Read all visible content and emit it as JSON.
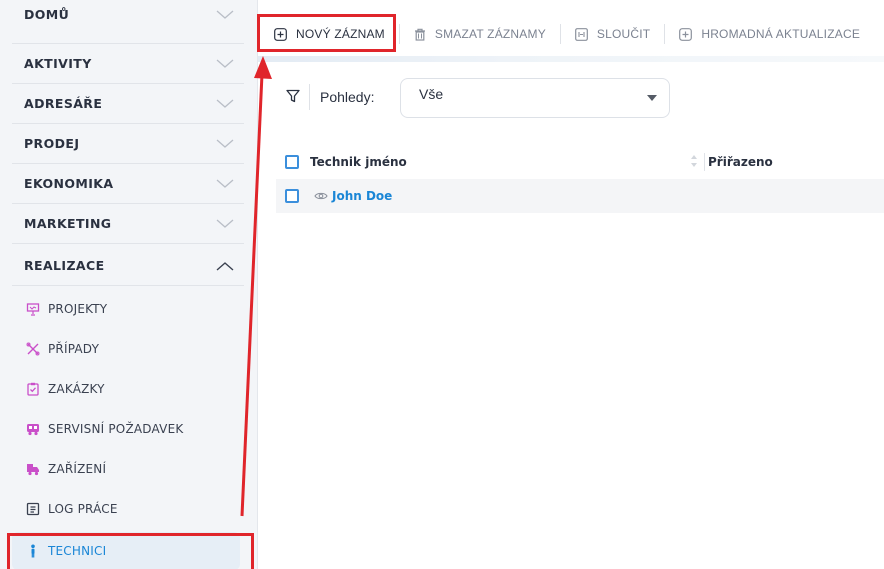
{
  "sidebar": {
    "sections": [
      {
        "label": "DOMŮ",
        "expanded": false
      },
      {
        "label": "AKTIVITY",
        "expanded": false
      },
      {
        "label": "ADRESÁŘE",
        "expanded": false
      },
      {
        "label": "PRODEJ",
        "expanded": false
      },
      {
        "label": "EKONOMIKA",
        "expanded": false
      },
      {
        "label": "MARKETING",
        "expanded": false
      },
      {
        "label": "REALIZACE",
        "expanded": true
      }
    ],
    "items": [
      {
        "label": "PROJEKTY",
        "icon": "presentation-icon",
        "color": "#c94fc9"
      },
      {
        "label": "PŘÍPADY",
        "icon": "tools-cross-icon",
        "color": "#c94fc9"
      },
      {
        "label": "ZAKÁZKY",
        "icon": "clipboard-check-icon",
        "color": "#c94fc9"
      },
      {
        "label": "SERVISNÍ POŽADAVEK",
        "icon": "truck-icon",
        "color": "#c94fc9"
      },
      {
        "label": "ZAŘÍZENÍ",
        "icon": "vehicle-icon",
        "color": "#c94fc9"
      },
      {
        "label": "LOG PRÁCE",
        "icon": "log-list-icon",
        "color": "#3a4150"
      },
      {
        "label": "TECHNICI",
        "icon": "person-icon",
        "color": "#1a86d6",
        "active": true
      }
    ]
  },
  "toolbar": {
    "new_record": "NOVÝ ZÁZNAM",
    "delete_records": "SMAZAT ZÁZNAMY",
    "merge": "SLOUČIT",
    "mass_update": "HROMADNÁ AKTUALIZACE"
  },
  "filter": {
    "label": "Pohledy:",
    "selected": "Vše"
  },
  "table": {
    "columns": [
      "Technik jméno",
      "Přiřazeno"
    ],
    "rows": [
      {
        "name": "John Doe",
        "assigned": ""
      }
    ]
  },
  "colors": {
    "accent": "#1a86d6",
    "annotation": "#e0252b",
    "module_icon": "#c94fc9"
  }
}
